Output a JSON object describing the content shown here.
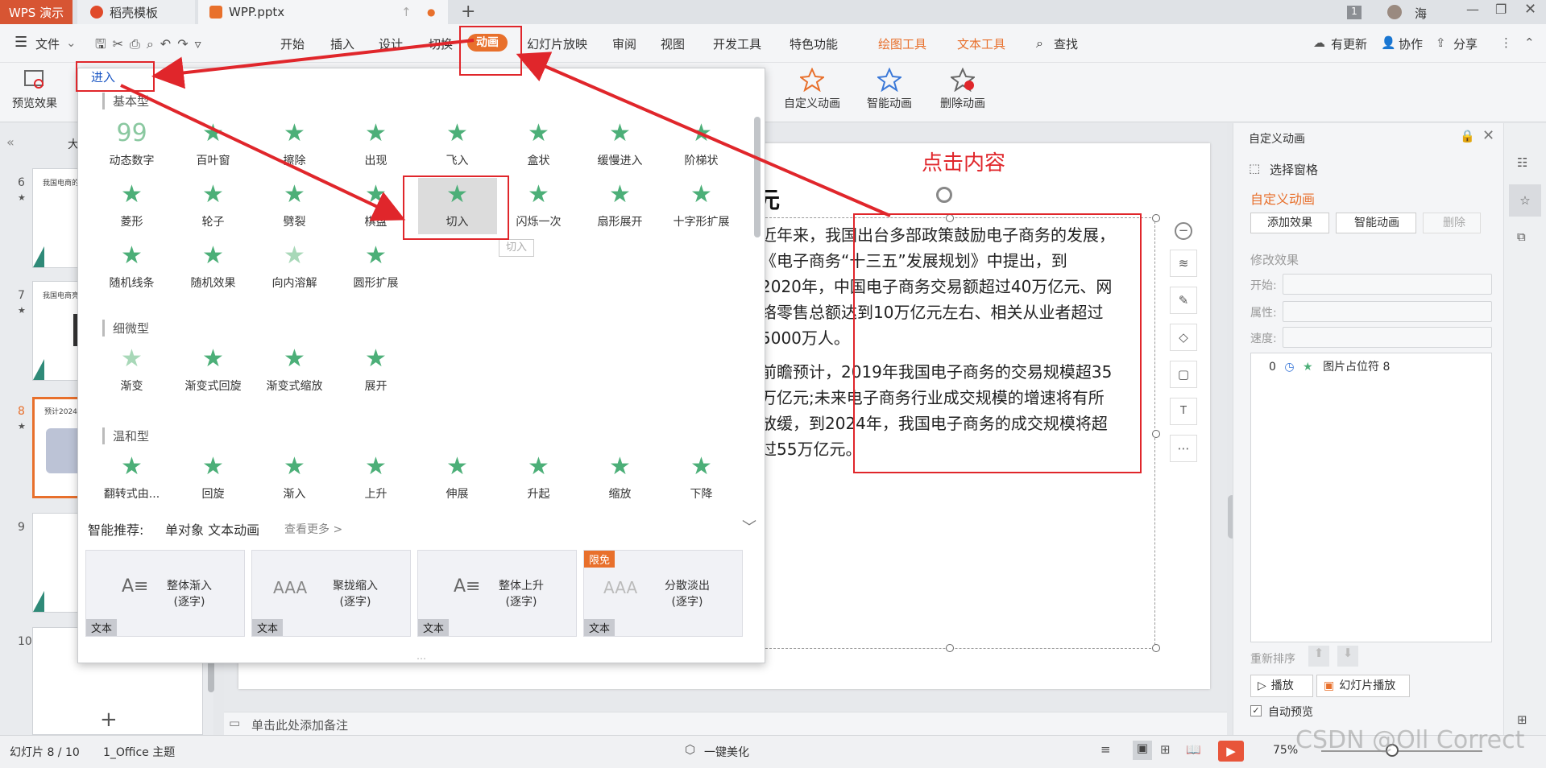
{
  "window": {
    "app_tab": "WPS 演示",
    "tabs": [
      {
        "label": "稻壳模板"
      },
      {
        "label": "WPP.pptx"
      }
    ],
    "user_name": "海",
    "badge": "1"
  },
  "menu": {
    "file_label": "文件",
    "items": [
      "开始",
      "插入",
      "设计",
      "切换",
      "动画",
      "幻灯片放映",
      "审阅",
      "视图",
      "开发工具",
      "特色功能"
    ],
    "tool_tabs": [
      "绘图工具",
      "文本工具"
    ],
    "search": "查找",
    "right": [
      "有更新",
      "协作",
      "分享"
    ]
  },
  "ribbon": {
    "preview": "预览效果",
    "custom_anim": "自定义动画",
    "smart_anim": "智能动画",
    "delete_anim": "删除动画"
  },
  "dropdown": {
    "enter_tab": "进入",
    "sections": [
      "基本型",
      "细微型",
      "温和型"
    ],
    "basic": [
      "动态数字",
      "百叶窗",
      "擦除",
      "出现",
      "飞入",
      "盒状",
      "缓慢进入",
      "阶梯状",
      "菱形",
      "轮子",
      "劈裂",
      "棋盘",
      "切入",
      "闪烁一次",
      "扇形展开",
      "十字形扩展",
      "随机线条",
      "随机效果",
      "向内溶解",
      "圆形扩展"
    ],
    "subtle": [
      "渐变",
      "渐变式回旋",
      "渐变式缩放",
      "展开"
    ],
    "moderate": [
      "翻转式由...",
      "回旋",
      "渐入",
      "上升",
      "伸展",
      "升起",
      "缩放",
      "下降"
    ],
    "tooltip": "切入",
    "smart_label": "智能推荐:",
    "smart_sub": "单对象 文本动画",
    "see_more": "查看更多 >",
    "cards": [
      {
        "line1": "整体渐入",
        "line2": "(逐字)",
        "tag": "文本"
      },
      {
        "line1": "聚拢缩入",
        "line2": "(逐字)",
        "tag": "文本"
      },
      {
        "line1": "整体上升",
        "line2": "(逐字)",
        "tag": "文本"
      },
      {
        "line1": "分散淡出",
        "line2": "(逐字)",
        "tag": "文本",
        "badge": "限免"
      }
    ]
  },
  "thumbs": [
    {
      "num": "6",
      "title": "我国电商的发"
    },
    {
      "num": "7",
      "title": "我国电商亮电"
    },
    {
      "num": "8",
      "title": "预计2024年"
    },
    {
      "num": "9",
      "title": ""
    },
    {
      "num": "10",
      "title": ""
    }
  ],
  "slide": {
    "heading_fragment": "元",
    "annotation": "点击内容",
    "lines": [
      "近年来，我国出台多部政策鼓励电子商务的发展，",
      "《电子商务“十三五”发展规划》中提出，到",
      "2020年，中国电子商务交易额超过40万亿元、网",
      "络零售总额达到10万亿元左右、相关从业者超过",
      "5000万人。",
      "前瞻预计，2019年我国电子商务的交易规模超35",
      "万亿元;未来电子商务行业成交规模的增速将有所",
      "放缓，到2024年，我国电子商务的成交规模将超",
      "过55万亿元。"
    ]
  },
  "notes": "单击此处添加备注",
  "right_panel": {
    "title": "自定义动画",
    "select_pane": "选择窗格",
    "section": "自定义动画",
    "add_effect": "添加效果",
    "smart_anim": "智能动画",
    "delete": "删除",
    "modify": "修改效果",
    "start": "开始:",
    "property": "属性:",
    "speed": "速度:",
    "list_item_num": "0",
    "list_item": "图片占位符 8",
    "reorder": "重新排序",
    "play": "播放",
    "slideshow": "幻灯片播放",
    "auto_preview": "自动预览"
  },
  "status": {
    "slide_info": "幻灯片 8 / 10",
    "theme": "1_Office 主题",
    "beautify": "一键美化",
    "zoom": "75%"
  },
  "watermark": "CSDN @Oll Correct",
  "colors": {
    "accent": "#e0262b",
    "app": "#d75533",
    "anim_active": "#e8702c",
    "star": "#4caf78"
  }
}
